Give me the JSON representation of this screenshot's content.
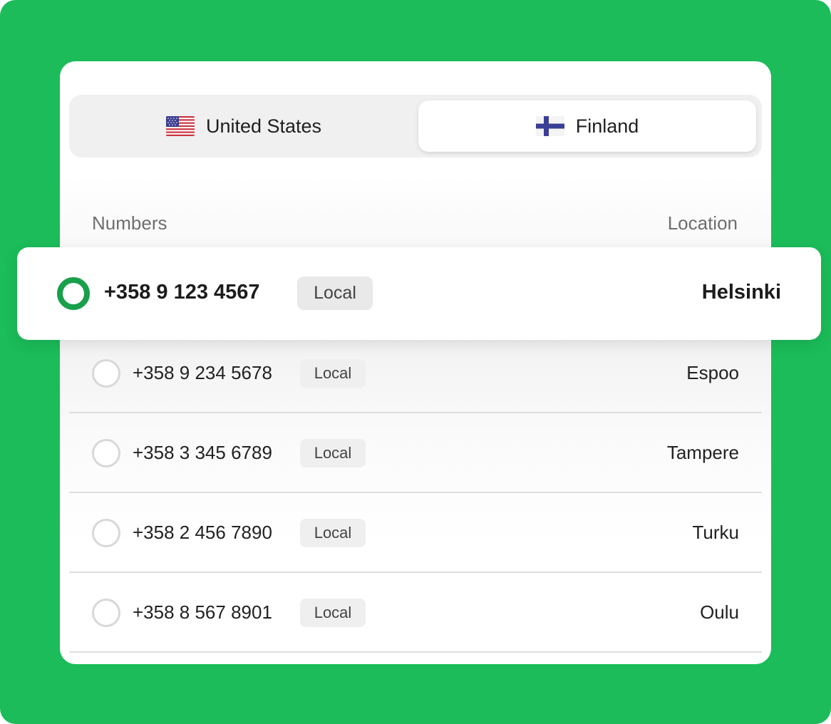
{
  "tabs": [
    {
      "label": "United States",
      "flag": "us-flag-icon",
      "selected": false
    },
    {
      "label": "Finland",
      "flag": "finland-flag-icon",
      "selected": true
    }
  ],
  "columns": {
    "numbers": "Numbers",
    "location": "Location"
  },
  "selected_number": {
    "number": "+358 9 123 4567",
    "type": "Local",
    "location": "Helsinki"
  },
  "numbers": [
    {
      "number": "+358 9 234 5678",
      "type": "Local",
      "location": "Espoo"
    },
    {
      "number": "+358 3 345 6789",
      "type": "Local",
      "location": "Tampere"
    },
    {
      "number": "+358 2 456 7890",
      "type": "Local",
      "location": "Turku"
    },
    {
      "number": "+358 8 567 8901",
      "type": "Local",
      "location": "Oulu"
    }
  ],
  "colors": {
    "background": "#1bbc59",
    "accent": "#1a9f4b"
  }
}
